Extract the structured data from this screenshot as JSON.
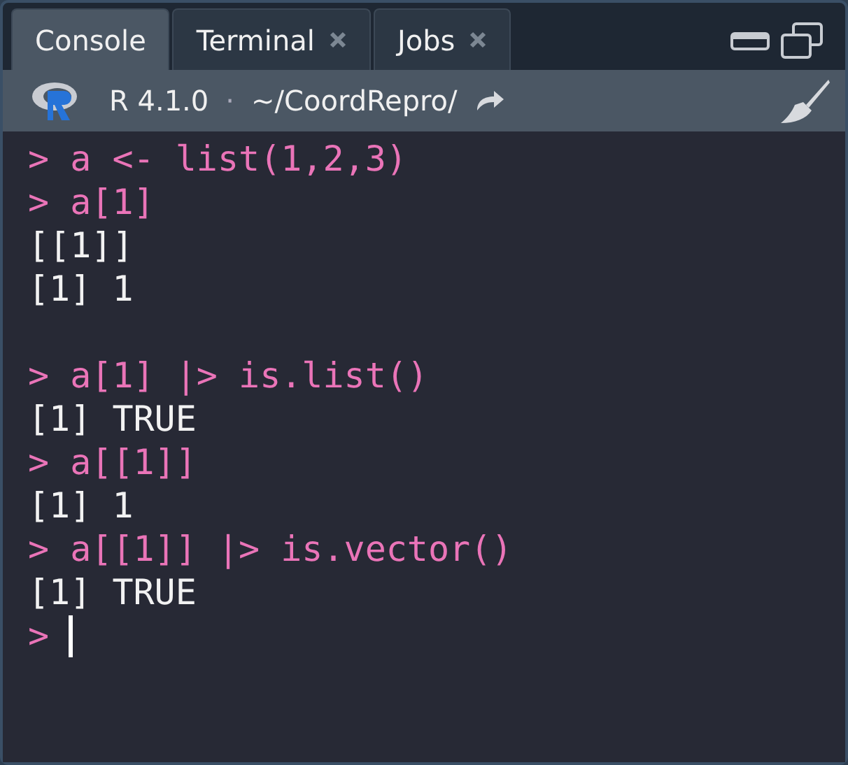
{
  "tabs": [
    {
      "label": "Console",
      "selected": true,
      "closable": false
    },
    {
      "label": "Terminal",
      "selected": false,
      "closable": true
    },
    {
      "label": "Jobs",
      "selected": false,
      "closable": true
    }
  ],
  "toolbar": {
    "version": "R 4.1.0",
    "separator": "·",
    "path": "~/CoordRepro/"
  },
  "console_lines": [
    {
      "kind": "input",
      "text": "> a <- list(1,2,3)"
    },
    {
      "kind": "input",
      "text": "> a[1]"
    },
    {
      "kind": "output",
      "text": "[[1]]"
    },
    {
      "kind": "output",
      "text": "[1] 1"
    },
    {
      "kind": "blank"
    },
    {
      "kind": "input",
      "text": "> a[1] |> is.list()"
    },
    {
      "kind": "output",
      "text": "[1] TRUE"
    },
    {
      "kind": "input",
      "text": "> a[[1]]"
    },
    {
      "kind": "output",
      "text": "[1] 1"
    },
    {
      "kind": "input",
      "text": "> a[[1]] |> is.vector()"
    },
    {
      "kind": "output",
      "text": "[1] TRUE"
    },
    {
      "kind": "prompt",
      "text": ">"
    }
  ]
}
